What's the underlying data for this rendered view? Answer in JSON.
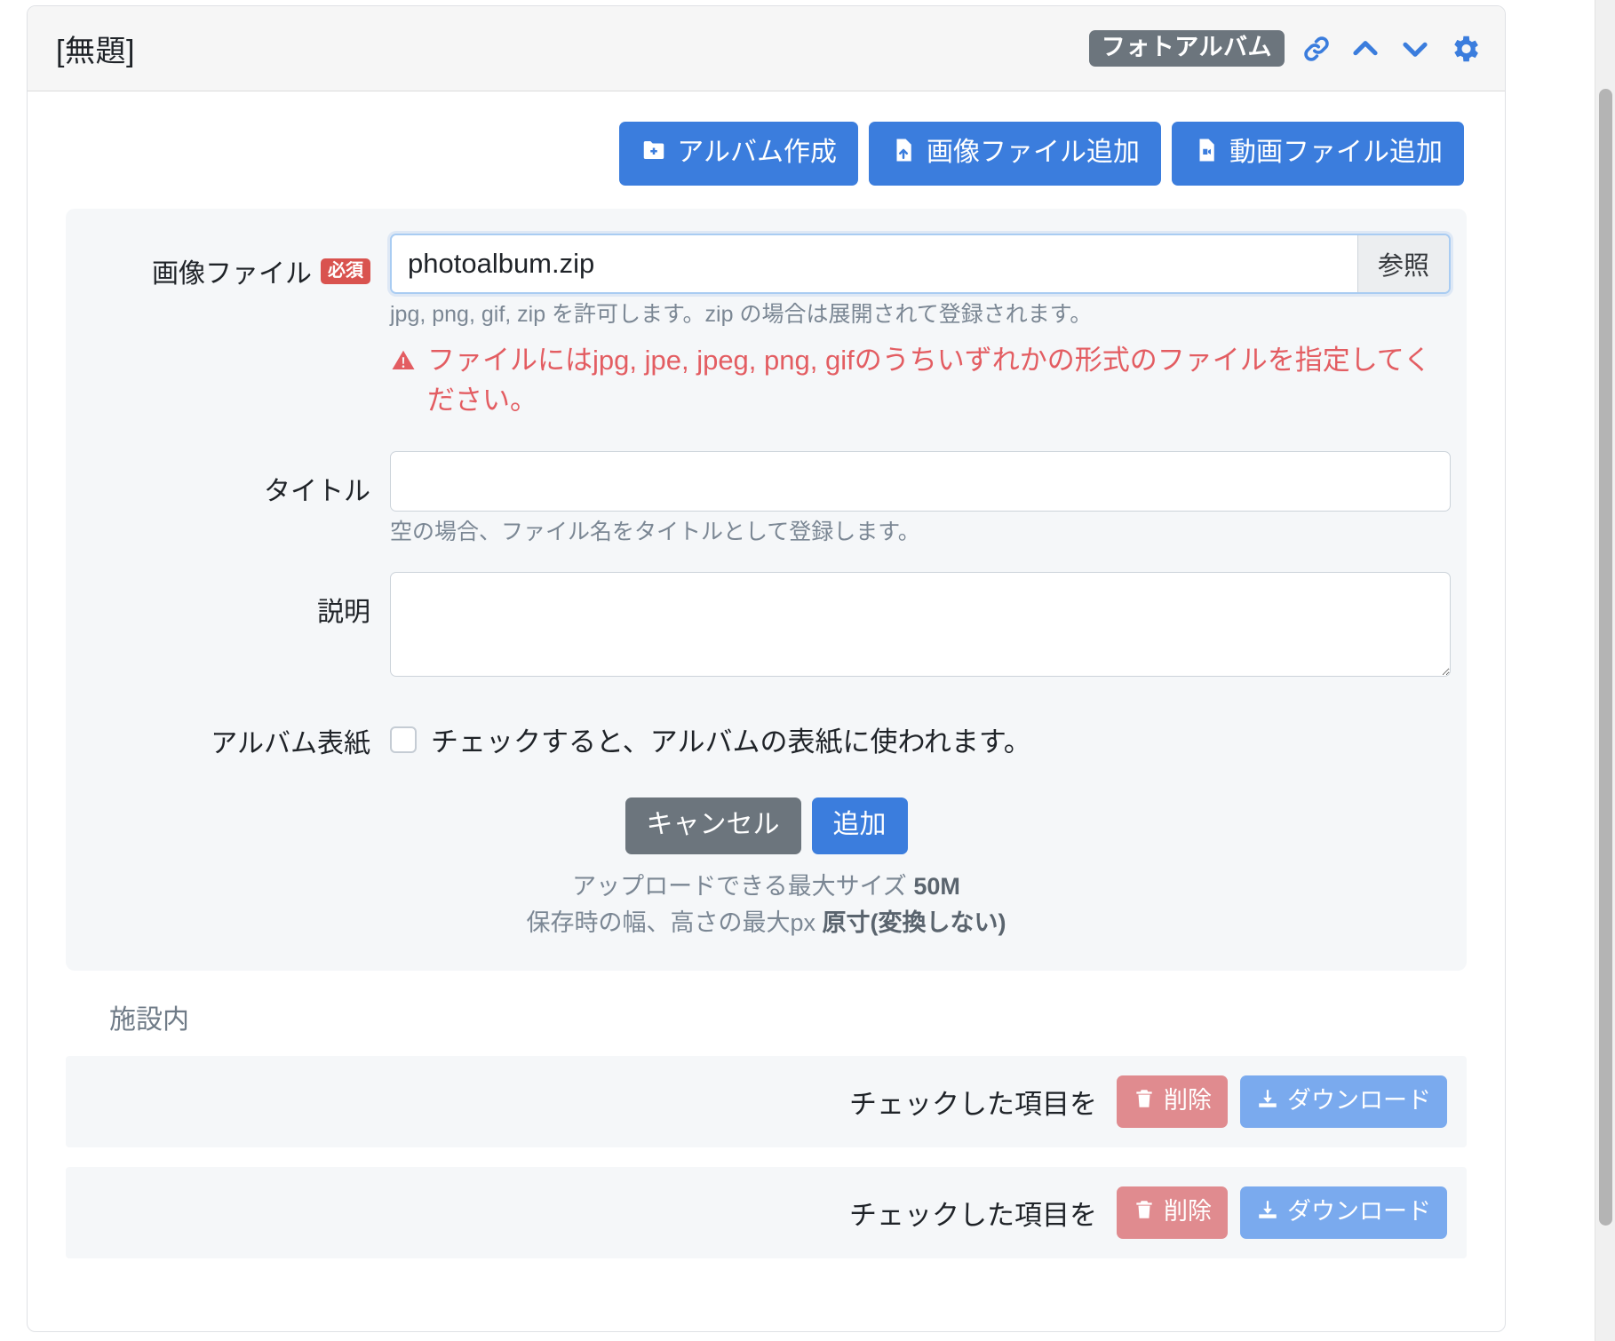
{
  "header": {
    "title": "[無題]",
    "badge": "フォトアルバム",
    "icons": [
      "link-icon",
      "chevron-up-icon",
      "chevron-down-icon",
      "gear-icon"
    ]
  },
  "toolbar": {
    "create_album": "アルバム作成",
    "add_image_file": "画像ファイル追加",
    "add_video_file": "動画ファイル追加"
  },
  "form": {
    "image_file": {
      "label": "画像ファイル",
      "required_badge": "必須",
      "value": "photoalbum.zip",
      "browse_label": "参照",
      "help": "jpg, png, gif, zip を許可します。zip の場合は展開されて登録されます。",
      "error": "ファイルにはjpg, jpe, jpeg, png, gifのうちいずれかの形式のファイルを指定してください。"
    },
    "title": {
      "label": "タイトル",
      "value": "",
      "help": "空の場合、ファイル名をタイトルとして登録します。"
    },
    "description": {
      "label": "説明",
      "value": ""
    },
    "album_cover": {
      "label": "アルバム表紙",
      "checkbox_label": "チェックすると、アルバムの表紙に使われます。",
      "checked": false
    },
    "cancel_label": "キャンセル",
    "submit_label": "追加",
    "max_size_note_prefix": "アップロードできる最大サイズ ",
    "max_size_value": "50M",
    "max_px_note_prefix": "保存時の幅、高さの最大px ",
    "max_px_value": "原寸(変換しない)"
  },
  "list_section": {
    "title": "施設内",
    "rows": [
      {
        "checked_items_label": "チェックした項目を",
        "delete_label": "削除",
        "download_label": "ダウンロード"
      },
      {
        "checked_items_label": "チェックした項目を",
        "delete_label": "削除",
        "download_label": "ダウンロード"
      }
    ]
  },
  "colors": {
    "primary": "#3b7ddd",
    "secondary": "#6c757d",
    "danger": "#d9534f",
    "danger_soft": "#e08b8f",
    "primary_soft": "#7aaaee",
    "error_text": "#e35d62",
    "panel_bg": "#f5f7f9"
  }
}
